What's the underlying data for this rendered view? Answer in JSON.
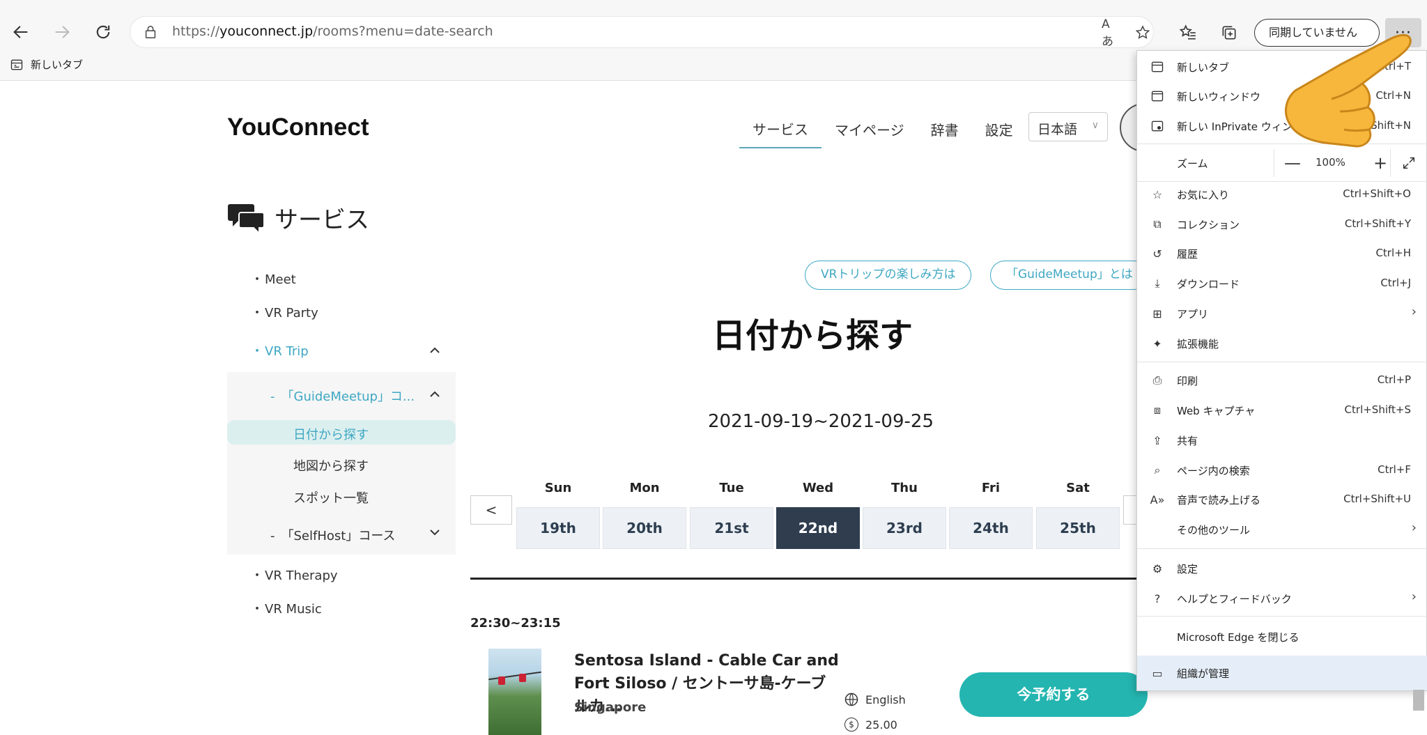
{
  "browser": {
    "url_prefix": "https://",
    "url_domain": "youconnect.jp",
    "url_path": "/rooms?menu=date-search",
    "read_aloud_icon": "Aあ",
    "sync_label": "同期していません",
    "more_label": "···"
  },
  "favorites_bar": {
    "items": [
      {
        "label": "新しいタブ"
      }
    ]
  },
  "site": {
    "logo": "YouConnect",
    "nav": [
      "サービス",
      "マイページ",
      "辞書",
      "設定"
    ],
    "language": "日本語",
    "section_title": "サービス"
  },
  "sidebar": {
    "meet": "Meet",
    "vr_party": "VR Party",
    "vr_trip": "VR Trip",
    "guide_meetup": "-　「GuideMeetup」コ...",
    "date_search": "日付から探す",
    "map_search": "地図から探す",
    "spot_list": "スポット一覧",
    "self_host": "-　「SelfHost」コース",
    "vr_therapy": "VR Therapy",
    "vr_music": "VR Music",
    "bullet": "・"
  },
  "main": {
    "pill_1": "VRトリップの楽しみ方は",
    "pill_2": "「GuideMeetup」とは",
    "heading": "日付から探す",
    "date_range": "2021-09-19~2021-09-25",
    "prev": "<",
    "days": [
      {
        "dow": "Sun",
        "date": "19th"
      },
      {
        "dow": "Mon",
        "date": "20th"
      },
      {
        "dow": "Tue",
        "date": "21st"
      },
      {
        "dow": "Wed",
        "date": "22nd"
      },
      {
        "dow": "Thu",
        "date": "23rd"
      },
      {
        "dow": "Fri",
        "date": "24th"
      },
      {
        "dow": "Sat",
        "date": "25th"
      }
    ],
    "selected_day": "22nd",
    "time_slot": "22:30~23:15",
    "tour_title": "Sentosa Island - Cable Car and Fort Siloso / セントーサ島-ケーブルカ...",
    "tour_location": "Singapore",
    "tour_language": "English",
    "tour_price": "25.00",
    "book_label": "今予約する"
  },
  "menu": {
    "new_tab": {
      "label": "新しいタブ",
      "shortcut": "Ctrl+T"
    },
    "new_window": {
      "label": "新しいウィンドウ",
      "shortcut": "Ctrl+N"
    },
    "inprivate": {
      "label": "新しい InPrivate ウィンドウ",
      "shortcut": "Ctrl+Shift+N"
    },
    "zoom": {
      "label": "ズーム",
      "value": "100%",
      "minus": "—",
      "plus": "+"
    },
    "favorites": {
      "label": "お気に入り",
      "shortcut": "Ctrl+Shift+O"
    },
    "collections": {
      "label": "コレクション",
      "shortcut": "Ctrl+Shift+Y"
    },
    "history": {
      "label": "履歴",
      "shortcut": "Ctrl+H"
    },
    "downloads": {
      "label": "ダウンロード",
      "shortcut": "Ctrl+J"
    },
    "apps": {
      "label": "アプリ"
    },
    "extensions": {
      "label": "拡張機能"
    },
    "print": {
      "label": "印刷",
      "shortcut": "Ctrl+P"
    },
    "web_capture": {
      "label": "Web キャプチャ",
      "shortcut": "Ctrl+Shift+S"
    },
    "share": {
      "label": "共有"
    },
    "find": {
      "label": "ページ内の検索",
      "shortcut": "Ctrl+F"
    },
    "read_aloud": {
      "label": "音声で読み上げる",
      "shortcut": "Ctrl+Shift+U"
    },
    "more_tools": {
      "label": "その他のツール"
    },
    "settings": {
      "label": "設定"
    },
    "help": {
      "label": "ヘルプとフィードバック"
    },
    "close": {
      "label": "Microsoft Edge を閉じる"
    },
    "managed": {
      "label": "組織が管理"
    }
  },
  "colors": {
    "accent": "#3ea7c2",
    "book_button": "#24b5b0",
    "selected_day": "#2f3d4f",
    "menu_highlight": "#e5eef8"
  }
}
